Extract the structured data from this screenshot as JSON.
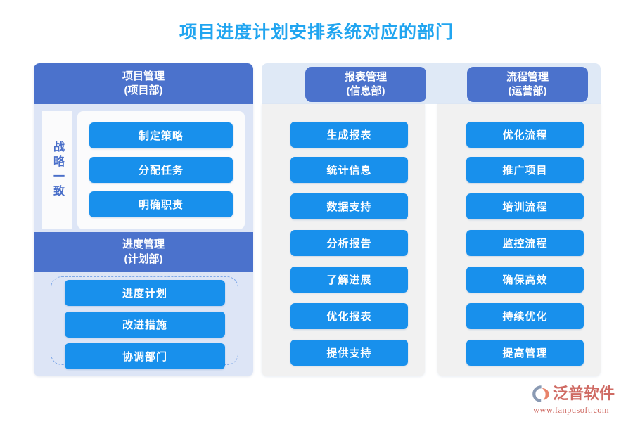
{
  "page": {
    "title": "项目进度计划安排系统对应的部门",
    "title_color": "#21a5f0",
    "background": "#ffffff"
  },
  "colors": {
    "header_blue": "#4b72cc",
    "pill_blue": "#1890ec",
    "col1_panel": "#dde5f6",
    "band": "#dfe9f6",
    "col_body": "#f1f1f1",
    "dashed_border": "#7fa8e8",
    "strategy_text": "#4a6fc9",
    "logo_red": "#cf6a63"
  },
  "columns": [
    {
      "id": "project-management",
      "header": {
        "line1": "项目管理",
        "line2": "(项目部)"
      },
      "side_label": "战略一致",
      "items": [
        "制定策略",
        "分配任务",
        "明确职责"
      ],
      "sub_section": {
        "id": "schedule-management",
        "header": {
          "line1": "进度管理",
          "line2": "(计划部)"
        },
        "items": [
          "进度计划",
          "改进措施",
          "协调部门"
        ]
      }
    },
    {
      "id": "report-management",
      "header": {
        "line1": "报表管理",
        "line2": "(信息部)"
      },
      "items": [
        "生成报表",
        "统计信息",
        "数据支持",
        "分析报告",
        "了解进展",
        "优化报表",
        "提供支持"
      ]
    },
    {
      "id": "process-management",
      "header": {
        "line1": "流程管理",
        "line2": "(运营部)"
      },
      "items": [
        "优化流程",
        "推广项目",
        "培训流程",
        "监控流程",
        "确保高效",
        "持续优化",
        "提高管理"
      ]
    }
  ],
  "logo": {
    "name": "泛普软件",
    "url": "www.fanpusoft.com",
    "mark_icon": "fanpu-swoosh-icon"
  }
}
